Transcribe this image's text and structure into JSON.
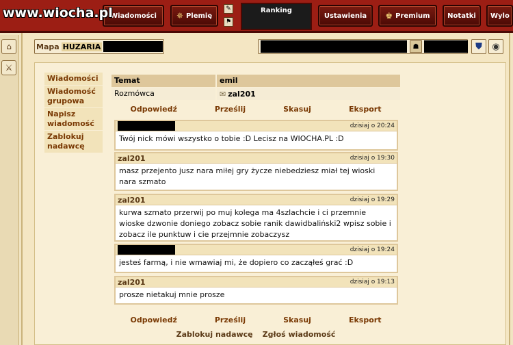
{
  "watermark": "www.wiocha.pl",
  "topbar": {
    "buttons": [
      {
        "label": "Wiadomości",
        "icon": "mail-icon"
      },
      {
        "label": "Plemię",
        "icon": "gear-icon"
      },
      {
        "label": "Ranking"
      },
      {
        "label": "Ustawienia"
      },
      {
        "label": "Premium",
        "icon": "crown-icon"
      },
      {
        "label": "Notatki"
      },
      {
        "label": "Wylo"
      }
    ]
  },
  "mapbar": {
    "label": "Mapa",
    "village": "HUZARIA"
  },
  "nav": [
    "Wiadomości",
    "Wiadomość grupowa",
    "Napisz wiadomość",
    "Zablokuj nadawcę"
  ],
  "header": {
    "col1": "Temat",
    "col2": "emil",
    "row_label": "Rozmówca",
    "row_value": "zal201"
  },
  "actions": {
    "reply": "Odpowiedź",
    "forward": "Prześlij",
    "delete": "Skasuj",
    "export": "Eksport"
  },
  "messages": [
    {
      "author": "",
      "time": "dzisiaj o 20:24",
      "body": "Twój nick mówi wszystko o tobie :D Lecisz na WIOCHA.PL :D"
    },
    {
      "author": "zal201",
      "time": "dzisiaj o 19:30",
      "body": "masz przejento jusz nara miłej gry życze niebedziesz miał tej wioski nara szmato"
    },
    {
      "author": "zal201",
      "time": "dzisiaj o 19:29",
      "body": "kurwa szmato przerwij po muj kolega ma 4szlachcie i ci przemnie wioske dzwonie doniego zobacz sobie ranik dawidbaliński2 wpisz sobie i zobacz ile punktuw i cie przejmnie zobaczysz"
    },
    {
      "author": "",
      "time": "dzisiaj o 19:24",
      "body": "jesteś farmą, i nie wmawiaj mi, że dopiero co zacząłeś grać :D"
    },
    {
      "author": "zal201",
      "time": "dzisiaj o 19:13",
      "body": "prosze nietakuj mnie prosze"
    }
  ],
  "footer": {
    "block": "Zablokuj nadawcę",
    "report": "Zgłoś wiadomość"
  }
}
